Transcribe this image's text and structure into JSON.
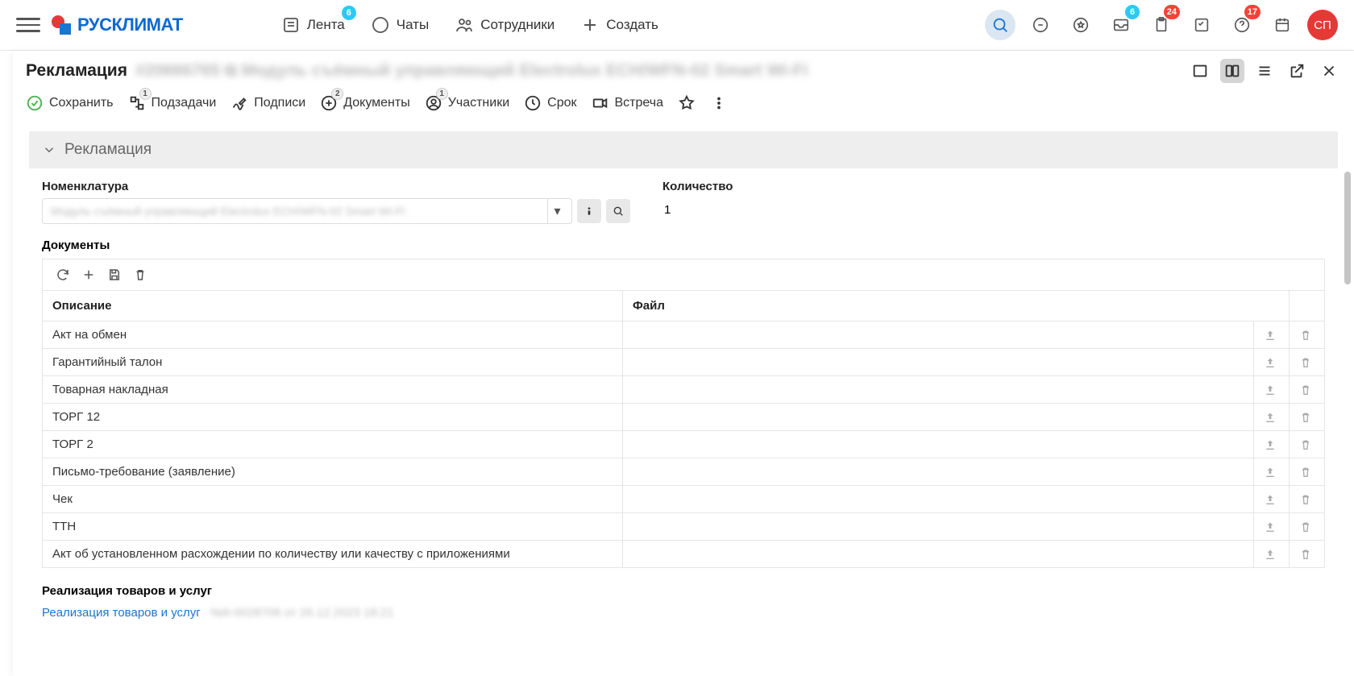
{
  "header": {
    "logo_text": "РУСКЛИМАТ",
    "nav": {
      "feed": {
        "label": "Лента",
        "badge": "6"
      },
      "chats": {
        "label": "Чаты"
      },
      "employees": {
        "label": "Сотрудники"
      },
      "create": {
        "label": "Создать"
      }
    },
    "right_icons": {
      "inbox_badge": "6",
      "clipboard_badge": "24",
      "help_badge": "17"
    },
    "avatar": "СП"
  },
  "page": {
    "title": "Рекламация",
    "title_blur": "#20666765 ⧉ Модуль съёмный управляющий Electrolux ECH/WFN-02 Smart Wi-Fi"
  },
  "actions": {
    "save": "Сохранить",
    "subtasks": {
      "label": "Подзадачи",
      "badge": "1"
    },
    "signatures": "Подписи",
    "documents": {
      "label": "Документы",
      "badge": "2"
    },
    "participants": {
      "label": "Участники",
      "badge": "1"
    },
    "deadline": "Срок",
    "meeting": "Встреча"
  },
  "section": {
    "title": "Рекламация",
    "nomenclature_label": "Номенклатура",
    "nomenclature_blur": "Модуль съёмный управляющий Electrolux ECH/WFN-02 Smart Wi-Fi",
    "quantity_label": "Количество",
    "quantity_value": "1"
  },
  "documents": {
    "label": "Документы",
    "columns": {
      "description": "Описание",
      "file": "Файл"
    },
    "rows": [
      {
        "desc": "Акт на обмен"
      },
      {
        "desc": "Гарантийный талон"
      },
      {
        "desc": "Товарная накладная"
      },
      {
        "desc": "ТОРГ 12"
      },
      {
        "desc": "ТОРГ 2"
      },
      {
        "desc": "Письмо-требование (заявление)"
      },
      {
        "desc": "Чек"
      },
      {
        "desc": "ТТН"
      },
      {
        "desc": "Акт об установленном расхождении по количеству или качеству с приложениями"
      }
    ]
  },
  "realization": {
    "label": "Реализация товаров и услуг",
    "link": "Реализация товаров и услуг",
    "link_blur": "№6-0028706 от 26.12.2023 18:21"
  }
}
